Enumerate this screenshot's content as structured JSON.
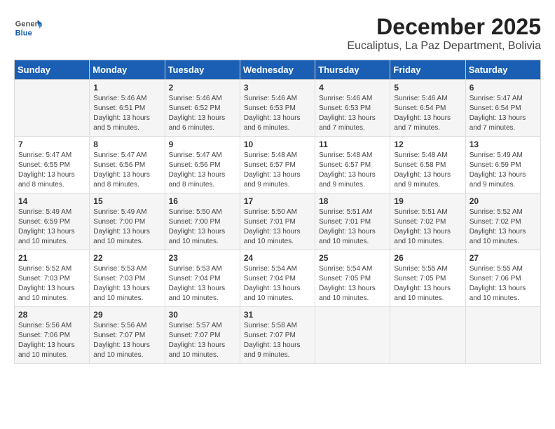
{
  "logo": {
    "general": "General",
    "blue": "Blue"
  },
  "title": "December 2025",
  "subtitle": "Eucaliptus, La Paz Department, Bolivia",
  "days_header": [
    "Sunday",
    "Monday",
    "Tuesday",
    "Wednesday",
    "Thursday",
    "Friday",
    "Saturday"
  ],
  "weeks": [
    [
      {
        "day": "",
        "info": ""
      },
      {
        "day": "1",
        "info": "Sunrise: 5:46 AM\nSunset: 6:51 PM\nDaylight: 13 hours\nand 5 minutes."
      },
      {
        "day": "2",
        "info": "Sunrise: 5:46 AM\nSunset: 6:52 PM\nDaylight: 13 hours\nand 6 minutes."
      },
      {
        "day": "3",
        "info": "Sunrise: 5:46 AM\nSunset: 6:53 PM\nDaylight: 13 hours\nand 6 minutes."
      },
      {
        "day": "4",
        "info": "Sunrise: 5:46 AM\nSunset: 6:53 PM\nDaylight: 13 hours\nand 7 minutes."
      },
      {
        "day": "5",
        "info": "Sunrise: 5:46 AM\nSunset: 6:54 PM\nDaylight: 13 hours\nand 7 minutes."
      },
      {
        "day": "6",
        "info": "Sunrise: 5:47 AM\nSunset: 6:54 PM\nDaylight: 13 hours\nand 7 minutes."
      }
    ],
    [
      {
        "day": "7",
        "info": "Sunrise: 5:47 AM\nSunset: 6:55 PM\nDaylight: 13 hours\nand 8 minutes."
      },
      {
        "day": "8",
        "info": "Sunrise: 5:47 AM\nSunset: 6:56 PM\nDaylight: 13 hours\nand 8 minutes."
      },
      {
        "day": "9",
        "info": "Sunrise: 5:47 AM\nSunset: 6:56 PM\nDaylight: 13 hours\nand 8 minutes."
      },
      {
        "day": "10",
        "info": "Sunrise: 5:48 AM\nSunset: 6:57 PM\nDaylight: 13 hours\nand 9 minutes."
      },
      {
        "day": "11",
        "info": "Sunrise: 5:48 AM\nSunset: 6:57 PM\nDaylight: 13 hours\nand 9 minutes."
      },
      {
        "day": "12",
        "info": "Sunrise: 5:48 AM\nSunset: 6:58 PM\nDaylight: 13 hours\nand 9 minutes."
      },
      {
        "day": "13",
        "info": "Sunrise: 5:49 AM\nSunset: 6:59 PM\nDaylight: 13 hours\nand 9 minutes."
      }
    ],
    [
      {
        "day": "14",
        "info": "Sunrise: 5:49 AM\nSunset: 6:59 PM\nDaylight: 13 hours\nand 10 minutes."
      },
      {
        "day": "15",
        "info": "Sunrise: 5:49 AM\nSunset: 7:00 PM\nDaylight: 13 hours\nand 10 minutes."
      },
      {
        "day": "16",
        "info": "Sunrise: 5:50 AM\nSunset: 7:00 PM\nDaylight: 13 hours\nand 10 minutes."
      },
      {
        "day": "17",
        "info": "Sunrise: 5:50 AM\nSunset: 7:01 PM\nDaylight: 13 hours\nand 10 minutes."
      },
      {
        "day": "18",
        "info": "Sunrise: 5:51 AM\nSunset: 7:01 PM\nDaylight: 13 hours\nand 10 minutes."
      },
      {
        "day": "19",
        "info": "Sunrise: 5:51 AM\nSunset: 7:02 PM\nDaylight: 13 hours\nand 10 minutes."
      },
      {
        "day": "20",
        "info": "Sunrise: 5:52 AM\nSunset: 7:02 PM\nDaylight: 13 hours\nand 10 minutes."
      }
    ],
    [
      {
        "day": "21",
        "info": "Sunrise: 5:52 AM\nSunset: 7:03 PM\nDaylight: 13 hours\nand 10 minutes."
      },
      {
        "day": "22",
        "info": "Sunrise: 5:53 AM\nSunset: 7:03 PM\nDaylight: 13 hours\nand 10 minutes."
      },
      {
        "day": "23",
        "info": "Sunrise: 5:53 AM\nSunset: 7:04 PM\nDaylight: 13 hours\nand 10 minutes."
      },
      {
        "day": "24",
        "info": "Sunrise: 5:54 AM\nSunset: 7:04 PM\nDaylight: 13 hours\nand 10 minutes."
      },
      {
        "day": "25",
        "info": "Sunrise: 5:54 AM\nSunset: 7:05 PM\nDaylight: 13 hours\nand 10 minutes."
      },
      {
        "day": "26",
        "info": "Sunrise: 5:55 AM\nSunset: 7:05 PM\nDaylight: 13 hours\nand 10 minutes."
      },
      {
        "day": "27",
        "info": "Sunrise: 5:55 AM\nSunset: 7:06 PM\nDaylight: 13 hours\nand 10 minutes."
      }
    ],
    [
      {
        "day": "28",
        "info": "Sunrise: 5:56 AM\nSunset: 7:06 PM\nDaylight: 13 hours\nand 10 minutes."
      },
      {
        "day": "29",
        "info": "Sunrise: 5:56 AM\nSunset: 7:07 PM\nDaylight: 13 hours\nand 10 minutes."
      },
      {
        "day": "30",
        "info": "Sunrise: 5:57 AM\nSunset: 7:07 PM\nDaylight: 13 hours\nand 10 minutes."
      },
      {
        "day": "31",
        "info": "Sunrise: 5:58 AM\nSunset: 7:07 PM\nDaylight: 13 hours\nand 9 minutes."
      },
      {
        "day": "",
        "info": ""
      },
      {
        "day": "",
        "info": ""
      },
      {
        "day": "",
        "info": ""
      }
    ]
  ]
}
